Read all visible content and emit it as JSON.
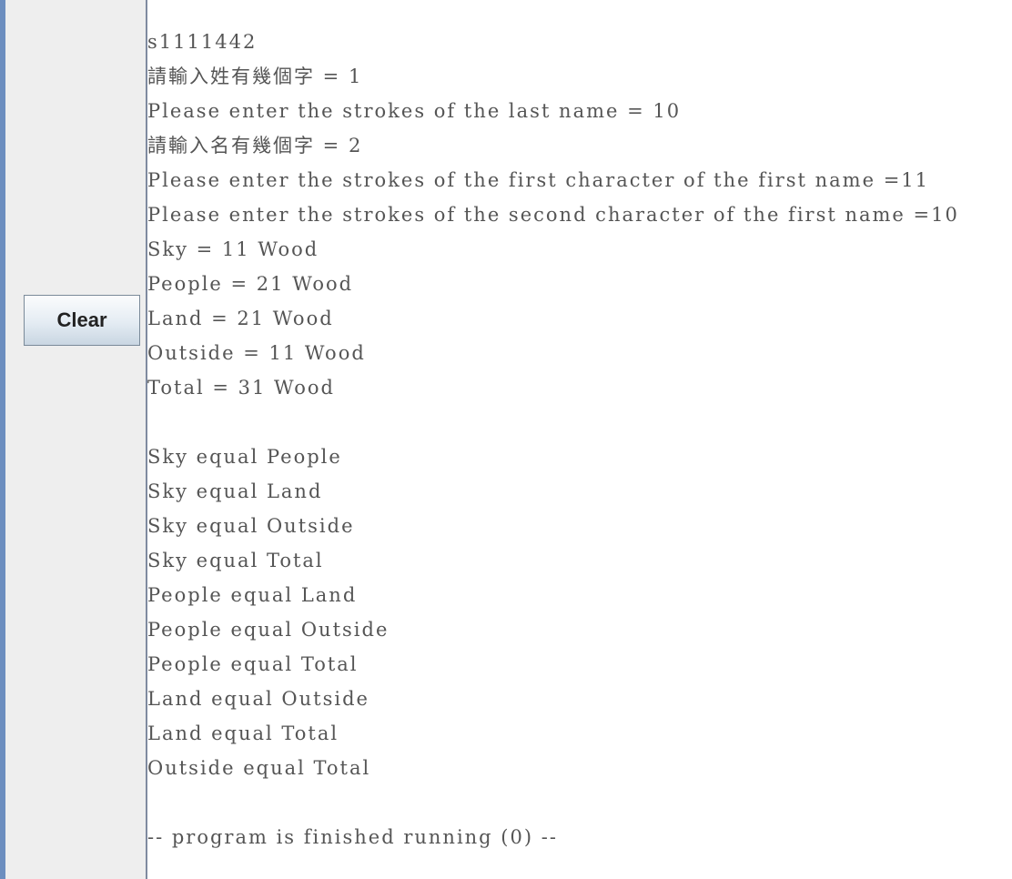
{
  "side_panel": {
    "clear_button_label": "Clear"
  },
  "console": {
    "lines": [
      "s1111442",
      "請輸入姓有幾個字 = 1",
      "Please enter the strokes of the last name = 10",
      "請輸入名有幾個字 = 2",
      "Please enter the strokes of the first character of the first name =11",
      "Please enter the strokes of the second character of the first name =10",
      "Sky = 11 Wood",
      "People = 21 Wood",
      "Land = 21 Wood",
      "Outside = 11 Wood",
      "Total = 31 Wood",
      "",
      "Sky equal People",
      "Sky equal Land",
      "Sky equal Outside",
      "Sky equal Total",
      "People equal Land",
      "People equal Outside",
      "People equal Total",
      "Land equal Outside",
      "Land equal Total",
      "Outside equal Total",
      "",
      "-- program is finished running (0) --"
    ]
  }
}
